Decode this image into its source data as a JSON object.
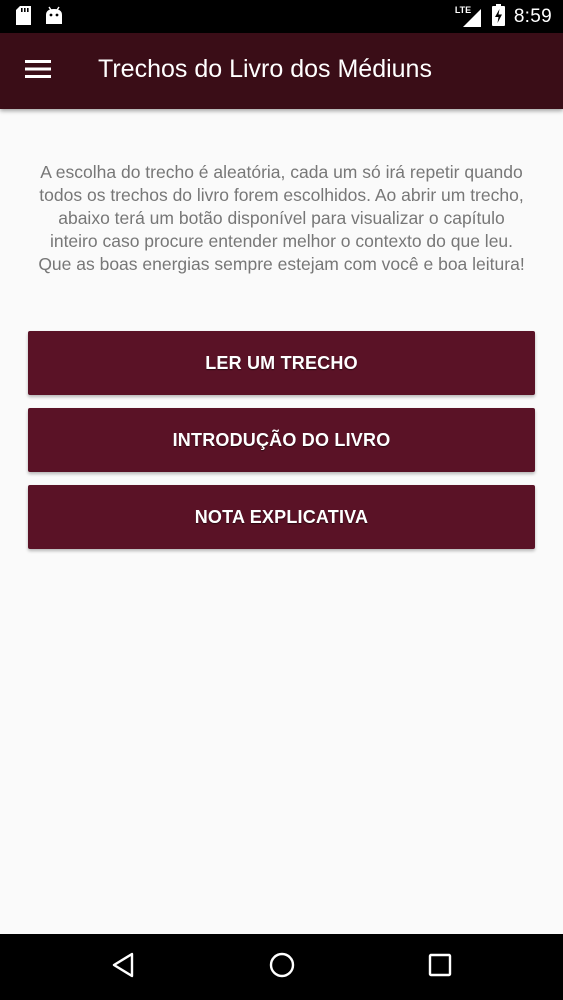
{
  "status_bar": {
    "network_label": "LTE",
    "time": "8:59",
    "icons": [
      "sd-card-icon",
      "android-icon",
      "signal-icon",
      "battery-charging-icon"
    ]
  },
  "app_bar": {
    "title": "Trechos do Livro dos Médiuns",
    "menu_icon": "hamburger-menu-icon"
  },
  "main": {
    "description": "A escolha do trecho é aleatória, cada um só irá repetir quando todos os trechos do livro forem escolhidos. Ao abrir um trecho, abaixo terá um botão disponível para visualizar o capítulo inteiro caso procure entender melhor o contexto do que leu. Que as boas energias sempre estejam com você e boa leitura!",
    "buttons": [
      {
        "label": "LER UM TRECHO"
      },
      {
        "label": "INTRODUÇÃO DO LIVRO"
      },
      {
        "label": "NOTA EXPLICATIVA"
      }
    ]
  },
  "nav_bar": {
    "icons": [
      "back-icon",
      "home-icon",
      "recents-icon"
    ]
  },
  "colors": {
    "app_bar": "#3a0d17",
    "button": "#5a1226",
    "background": "#fafafa",
    "text_muted": "#777777"
  }
}
